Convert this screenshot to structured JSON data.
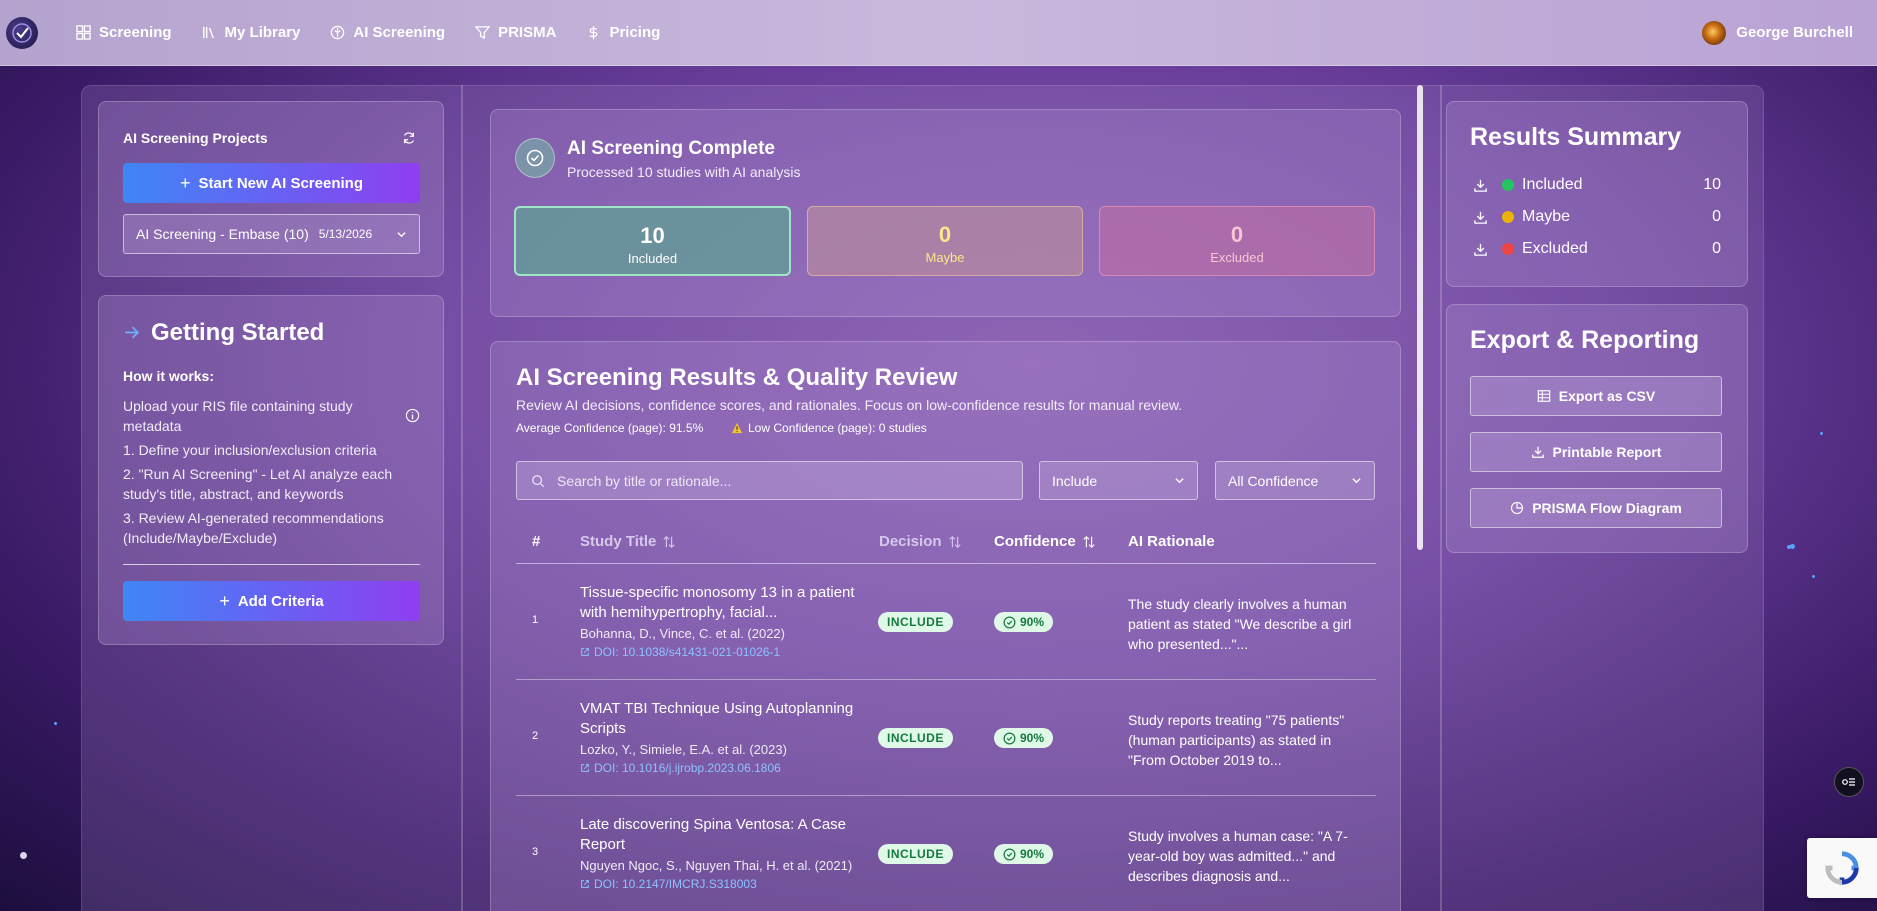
{
  "nav": {
    "items": [
      {
        "label": "Screening",
        "icon": "grid-icon"
      },
      {
        "label": "My Library",
        "icon": "library-icon"
      },
      {
        "label": "AI Screening",
        "icon": "ai-icon"
      },
      {
        "label": "PRISMA",
        "icon": "filter-icon"
      },
      {
        "label": "Pricing",
        "icon": "dollar-icon"
      }
    ],
    "user_name": "George Burchell"
  },
  "projects": {
    "title": "AI Screening Projects",
    "start_button": "Start New AI Screening",
    "selected_project": "AI Screening - Embase (10)",
    "selected_date": "5/13/2026"
  },
  "getting_started": {
    "title": "Getting Started",
    "how_it_works": "How it works:",
    "step_upload": "Upload your RIS file containing study metadata",
    "step_1": "1. Define your inclusion/exclusion criteria",
    "step_2": "2. \"Run AI Screening\" - Let AI analyze each study's title, abstract, and keywords",
    "step_3": "3. Review AI-generated recommendations (Include/Maybe/Exclude)",
    "add_criteria": "Add Criteria"
  },
  "complete": {
    "title": "AI Screening Complete",
    "subtitle": "Processed 10 studies with AI analysis",
    "included_count": "10",
    "included_label": "Included",
    "maybe_count": "0",
    "maybe_label": "Maybe",
    "excluded_count": "0",
    "excluded_label": "Excluded"
  },
  "results": {
    "title": "AI Screening Results & Quality Review",
    "subtitle": "Review AI decisions, confidence scores, and rationales. Focus on low-confidence results for manual review.",
    "avg_confidence": "Average Confidence (page): 91.5%",
    "low_confidence": "Low Confidence (page): 0 studies",
    "search_placeholder": "Search by title or rationale...",
    "decision_filter": "Include",
    "confidence_filter": "All Confidence",
    "columns": {
      "num": "#",
      "title": "Study Title",
      "decision": "Decision",
      "confidence": "Confidence",
      "rationale": "AI Rationale"
    },
    "rows": [
      {
        "num": "1",
        "title": "Tissue-specific monosomy 13 in a patient with hemihypertrophy, facial...",
        "authors": "Bohanna, D., Vince, C. et al. (2022)",
        "doi": "DOI: 10.1038/s41431-021-01026-1",
        "decision": "INCLUDE",
        "confidence": "90%",
        "rationale": "The study clearly involves a human patient as stated \"We describe a girl who presented...\"..."
      },
      {
        "num": "2",
        "title": "VMAT TBI Technique Using Autoplanning Scripts",
        "authors": "Lozko, Y., Simiele, E.A. et al. (2023)",
        "doi": "DOI: 10.1016/j.ijrobp.2023.06.1806",
        "decision": "INCLUDE",
        "confidence": "90%",
        "rationale": "Study reports treating \"75 patients\" (human participants) as stated in \"From October 2019 to..."
      },
      {
        "num": "3",
        "title": "Late discovering Spina Ventosa: A Case Report",
        "authors": "Nguyen Ngoc, S., Nguyen Thai, H. et al. (2021)",
        "doi": "DOI: 10.2147/IMCRJ.S318003",
        "decision": "INCLUDE",
        "confidence": "90%",
        "rationale": "Study involves a human case: \"A 7-year-old boy was admitted...\" and describes diagnosis and..."
      }
    ]
  },
  "summary": {
    "title": "Results Summary",
    "included_label": "Included",
    "included_value": "10",
    "included_color": "#22c55e",
    "maybe_label": "Maybe",
    "maybe_value": "0",
    "maybe_color": "#eab308",
    "excluded_label": "Excluded",
    "excluded_value": "0",
    "excluded_color": "#ef4444"
  },
  "export": {
    "title": "Export & Reporting",
    "csv": "Export as CSV",
    "printable": "Printable Report",
    "prisma": "PRISMA Flow Diagram"
  }
}
